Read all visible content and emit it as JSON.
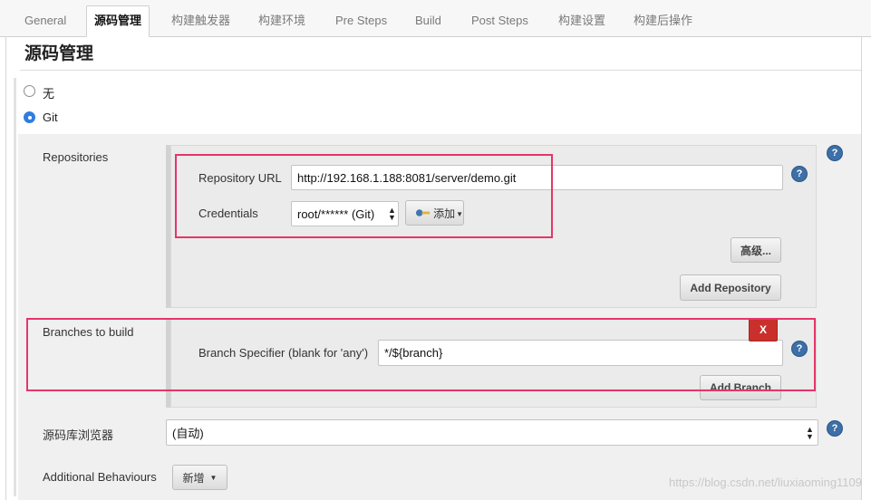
{
  "tabs": [
    {
      "label": "General"
    },
    {
      "label": "源码管理"
    },
    {
      "label": "构建触发器"
    },
    {
      "label": "构建环境"
    },
    {
      "label": "Pre Steps"
    },
    {
      "label": "Build"
    },
    {
      "label": "Post Steps"
    },
    {
      "label": "构建设置"
    },
    {
      "label": "构建后操作"
    }
  ],
  "section_title": "源码管理",
  "scm_options": [
    {
      "label": "无",
      "selected": false
    },
    {
      "label": "Git",
      "selected": true
    }
  ],
  "repositories": {
    "label": "Repositories",
    "url_label": "Repository URL",
    "url_value": "http://192.168.1.188:8081/server/demo.git",
    "credentials_label": "Credentials",
    "credentials_value": "root/****** (Git)",
    "add_label": "添加",
    "advanced_label": "高级...",
    "add_repository_label": "Add Repository"
  },
  "branches": {
    "label": "Branches to build",
    "delete_label": "X",
    "specifier_label": "Branch Specifier (blank for 'any')",
    "specifier_value": "*/${branch}",
    "add_branch_label": "Add Branch"
  },
  "browser": {
    "label": "源码库浏览器",
    "value": "(自动)"
  },
  "behaviours": {
    "label": "Additional Behaviours",
    "button_label": "新增"
  },
  "help_label": "?",
  "watermark": "https://blog.csdn.net/liuxiaoming1109",
  "colors": {
    "accent_blue": "#2f7de1",
    "help_blue": "#3d6fa8",
    "highlight_red": "#e5356a",
    "delete_red": "#c9302c"
  },
  "icons": {
    "help": "question-circle-icon",
    "add_key": "key-icon",
    "dropdown": "caret-down-icon"
  }
}
